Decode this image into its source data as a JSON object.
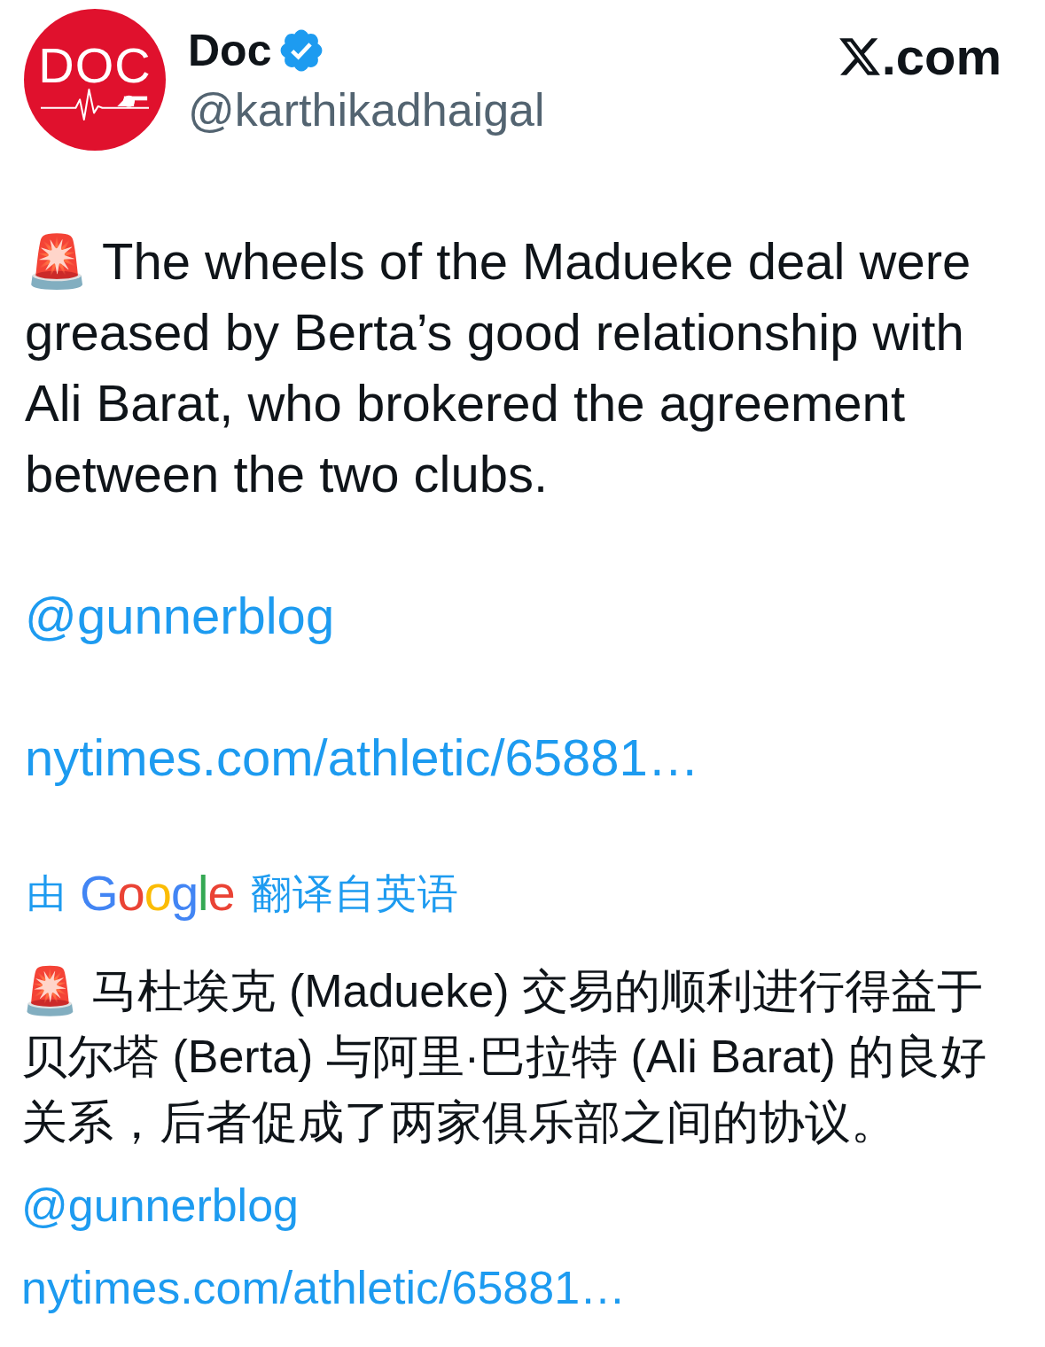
{
  "author": {
    "avatar_text": "DOC",
    "name": "Doc",
    "verified": true,
    "handle": "@karthikadhaigal"
  },
  "site_badge": {
    "text": ".com"
  },
  "post": {
    "text": "🚨 The wheels of the Madueke deal were greased by Berta’s good relationship with Ali Barat, who brokered the agreement between the two clubs.",
    "mention": "@gunnerblog",
    "link": "nytimes.com/athletic/65881…"
  },
  "translation": {
    "prefix": "由",
    "provider": "Google",
    "suffix": "翻译自英语",
    "text": "🚨 马杜埃克 (Madueke) 交易的顺利进行得益于贝尔塔 (Berta) 与阿里·巴拉特 (Ali Barat) 的良好关系，后者促成了两家俱乐部之间的协议。",
    "mention": "@gunnerblog",
    "link": "nytimes.com/athletic/65881…"
  }
}
